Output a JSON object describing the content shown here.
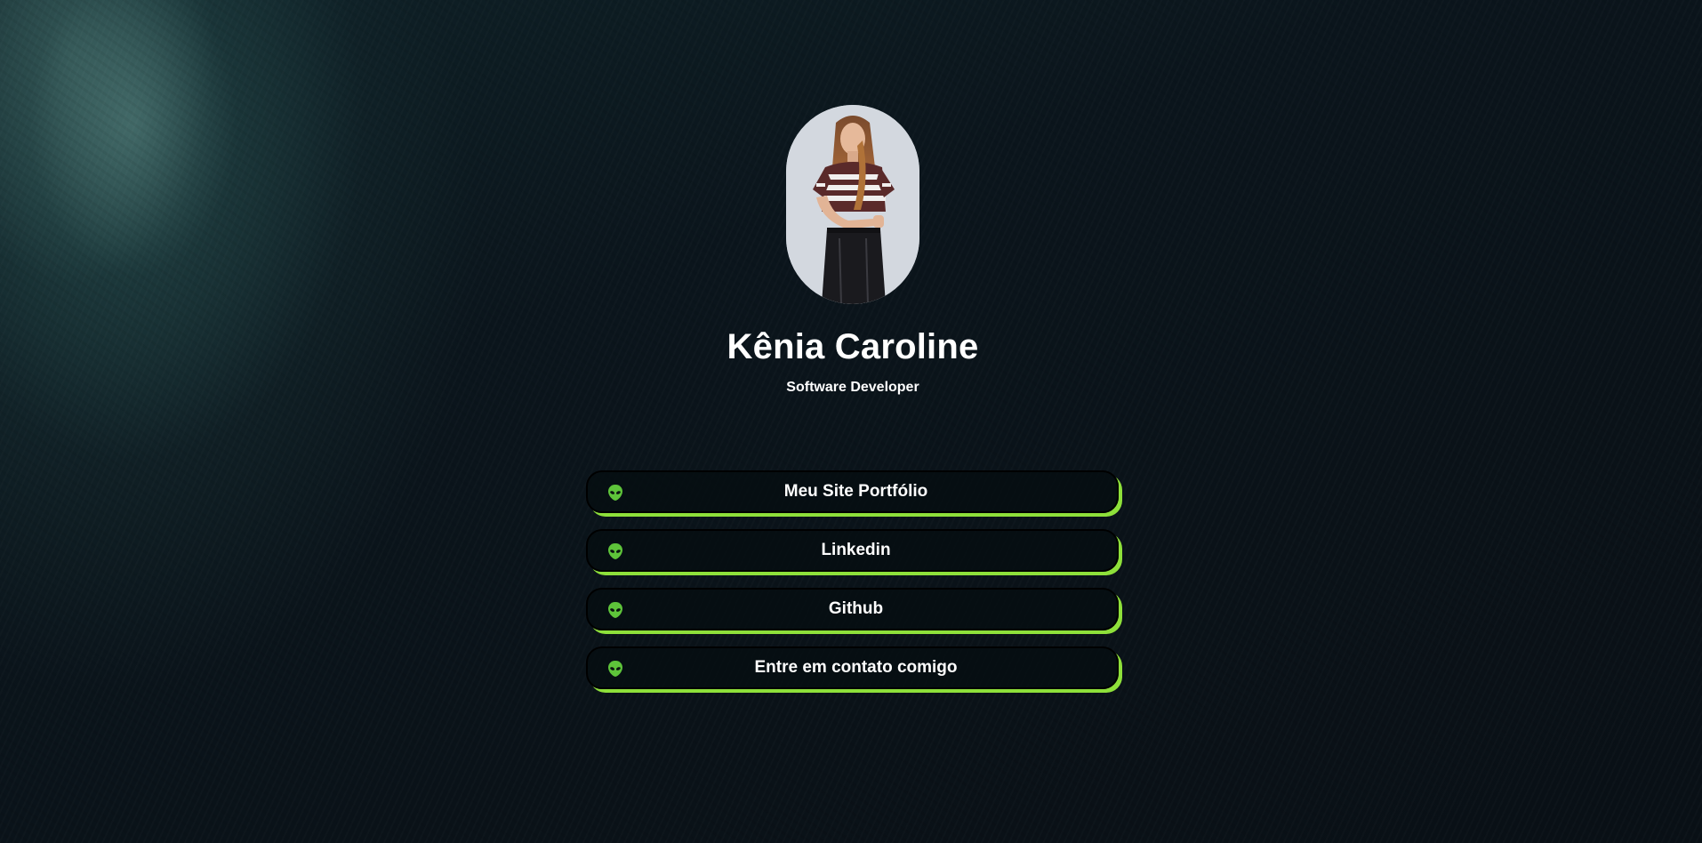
{
  "profile": {
    "name": "Kênia Caroline",
    "role": "Software Developer"
  },
  "links": [
    {
      "label": "Meu Site Portfólio",
      "icon": "alien-icon"
    },
    {
      "label": "Linkedin",
      "icon": "alien-icon"
    },
    {
      "label": "Github",
      "icon": "alien-icon"
    },
    {
      "label": "Entre em contato comigo",
      "icon": "alien-icon"
    }
  ],
  "colors": {
    "accent": "#8ee03a",
    "background": "#0b141b",
    "button_bg": "#060e12",
    "alien_green": "#5ec43a"
  }
}
